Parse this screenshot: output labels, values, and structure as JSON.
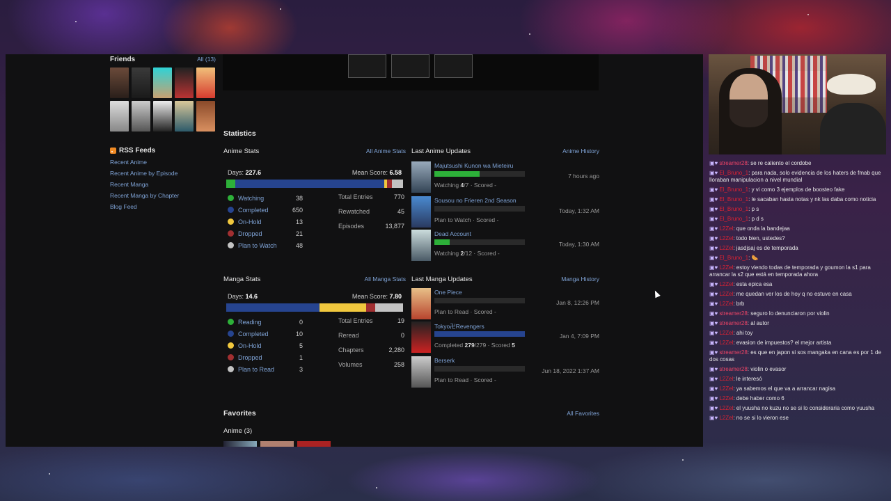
{
  "friends": {
    "title": "Friends",
    "all_link": "All (13)"
  },
  "rss": {
    "title": "RSS Feeds",
    "items": [
      "Recent Anime",
      "Recent Anime by Episode",
      "Recent Manga",
      "Recent Manga by Chapter",
      "Blog Feed"
    ]
  },
  "statistics": {
    "title": "Statistics"
  },
  "anime_stats": {
    "title": "Anime Stats",
    "link": "All Anime Stats",
    "days_label": "Days:",
    "days": "227.6",
    "mean_label": "Mean Score:",
    "mean": "6.58",
    "legend": [
      {
        "label": "Watching",
        "value": "38",
        "color": "#2db039"
      },
      {
        "label": "Completed",
        "value": "650",
        "color": "#26448f"
      },
      {
        "label": "On-Hold",
        "value": "13",
        "color": "#f1c83e"
      },
      {
        "label": "Dropped",
        "value": "21",
        "color": "#a12f31"
      },
      {
        "label": "Plan to Watch",
        "value": "48",
        "color": "#c3c3c3"
      }
    ],
    "totals": [
      {
        "label": "Total Entries",
        "value": "770"
      },
      {
        "label": "Rewatched",
        "value": "45"
      },
      {
        "label": "Episodes",
        "value": "13,877"
      }
    ]
  },
  "manga_stats": {
    "title": "Manga Stats",
    "link": "All Manga Stats",
    "days_label": "Days:",
    "days": "14.6",
    "mean_label": "Mean Score:",
    "mean": "7.80",
    "legend": [
      {
        "label": "Reading",
        "value": "0",
        "color": "#2db039"
      },
      {
        "label": "Completed",
        "value": "10",
        "color": "#26448f"
      },
      {
        "label": "On-Hold",
        "value": "5",
        "color": "#f1c83e"
      },
      {
        "label": "Dropped",
        "value": "1",
        "color": "#a12f31"
      },
      {
        "label": "Plan to Read",
        "value": "3",
        "color": "#c3c3c3"
      }
    ],
    "totals": [
      {
        "label": "Total Entries",
        "value": "19"
      },
      {
        "label": "Reread",
        "value": "0"
      },
      {
        "label": "Chapters",
        "value": "2,280"
      },
      {
        "label": "Volumes",
        "value": "258"
      }
    ]
  },
  "anime_updates": {
    "title": "Last Anime Updates",
    "link": "Anime History",
    "items": [
      {
        "title": "Majutsushi Kunon wa Mieteiru",
        "status": "Watching",
        "progress": "4",
        "total": "/7",
        "suffix": " · Scored -",
        "time": "7 hours ago",
        "fraction": 0.5,
        "color": "#2db039"
      },
      {
        "title": "Sousou no Frieren 2nd Season",
        "status": "Plan to Watch · Scored -",
        "progress": "",
        "total": "",
        "suffix": "",
        "time": "Today, 1:32 AM",
        "fraction": 0,
        "color": "#c3c3c3"
      },
      {
        "title": "Dead Account",
        "status": "Watching",
        "progress": "2",
        "total": "/12",
        "suffix": " · Scored -",
        "time": "Today, 1:30 AM",
        "fraction": 0.17,
        "color": "#2db039"
      }
    ]
  },
  "manga_updates": {
    "title": "Last Manga Updates",
    "link": "Manga History",
    "items": [
      {
        "title": "One Piece",
        "status": "Plan to Read · Scored -",
        "time": "Jan 8, 12:26 PM",
        "fraction": 0,
        "color": "#c3c3c3"
      },
      {
        "title": "Tokyo卍Revengers",
        "status": "Completed",
        "progress": "279",
        "total": "/279 · Scored ",
        "score": "5",
        "time": "Jan 4, 7:09 PM",
        "fraction": 1,
        "color": "#26448f"
      },
      {
        "title": "Berserk",
        "status": "Plan to Read · Scored -",
        "time": "Jun 18, 2022 1:37 AM",
        "fraction": 0,
        "color": "#c3c3c3"
      }
    ]
  },
  "favorites": {
    "title": "Favorites",
    "link": "All Favorites",
    "anime_label": "Anime (3)"
  },
  "chat": [
    {
      "user": "streamer28",
      "msg": ": se re caliento el cordobe",
      "pink": true
    },
    {
      "user": "El_Bruno_1",
      "msg": ": para nada, solo evidencia de los haters de fmab que lloraban manipulacion a nivel mundial",
      "pink": false
    },
    {
      "user": "El_Bruno_1",
      "msg": ": y vi como 3 ejemplos de boosteo fake",
      "pink": false
    },
    {
      "user": "El_Bruno_1",
      "msg": ": le sacaban hasta notas y nk las daba como noticia",
      "pink": false
    },
    {
      "user": "El_Bruno_1",
      "msg": ": p s",
      "pink": false
    },
    {
      "user": "El_Bruno_1",
      "msg": ": p d s",
      "pink": false
    },
    {
      "user": "L2Zel",
      "msg": ": que onda la bandejaa",
      "pink": false
    },
    {
      "user": "L2Zel",
      "msg": ": todo bien, ustedes?",
      "pink": false
    },
    {
      "user": "L2Zel",
      "msg": ": jasdjsaj es de temporada",
      "pink": false
    },
    {
      "user": "El_Bruno_1",
      "msg": ": 🌭",
      "pink": false
    },
    {
      "user": "L2Zel",
      "msg": ": estoy viendo todas de temporada y goumon la s1 para arrancar la s2 que está en temporada ahora",
      "pink": false
    },
    {
      "user": "L2Zel",
      "msg": ": esta epica esa",
      "pink": false
    },
    {
      "user": "L2Zel",
      "msg": ": me quedan ver los de hoy q no estuve en casa",
      "pink": false
    },
    {
      "user": "L2Zel",
      "msg": ": brb",
      "pink": false
    },
    {
      "user": "streamer28",
      "msg": ": seguro lo denunciaron por violin",
      "pink": true
    },
    {
      "user": "streamer28",
      "msg": ": al autor",
      "pink": true
    },
    {
      "user": "L2Zel",
      "msg": ": ahi toy",
      "pink": false
    },
    {
      "user": "L2Zel",
      "msg": ": evasion de impuestos? el mejor artista",
      "pink": false
    },
    {
      "user": "streamer28",
      "msg": ": es que en japon si sos mangaka en cana es por 1 de dos cosas",
      "pink": true
    },
    {
      "user": "streamer28",
      "msg": ": violin o evasor",
      "pink": true
    },
    {
      "user": "L2Zel",
      "msg": ": le interesó",
      "pink": false
    },
    {
      "user": "L2Zel",
      "msg": ": ya sabemos el que va a arrancar nagisa",
      "pink": false
    },
    {
      "user": "L2Zel",
      "msg": ": debe haber como 6",
      "pink": false
    },
    {
      "user": "L2Zel",
      "msg": ": el yuusha no kuzu no se si lo consideraria como yuusha",
      "pink": false
    },
    {
      "user": "L2Zel",
      "msg": ": no se si lo vieron ese",
      "pink": false
    }
  ],
  "colors": {
    "link": "#7fa3d6",
    "watching": "#2db039",
    "completed": "#26448f",
    "on_hold": "#f1c83e",
    "dropped": "#a12f31",
    "plan": "#c3c3c3"
  }
}
